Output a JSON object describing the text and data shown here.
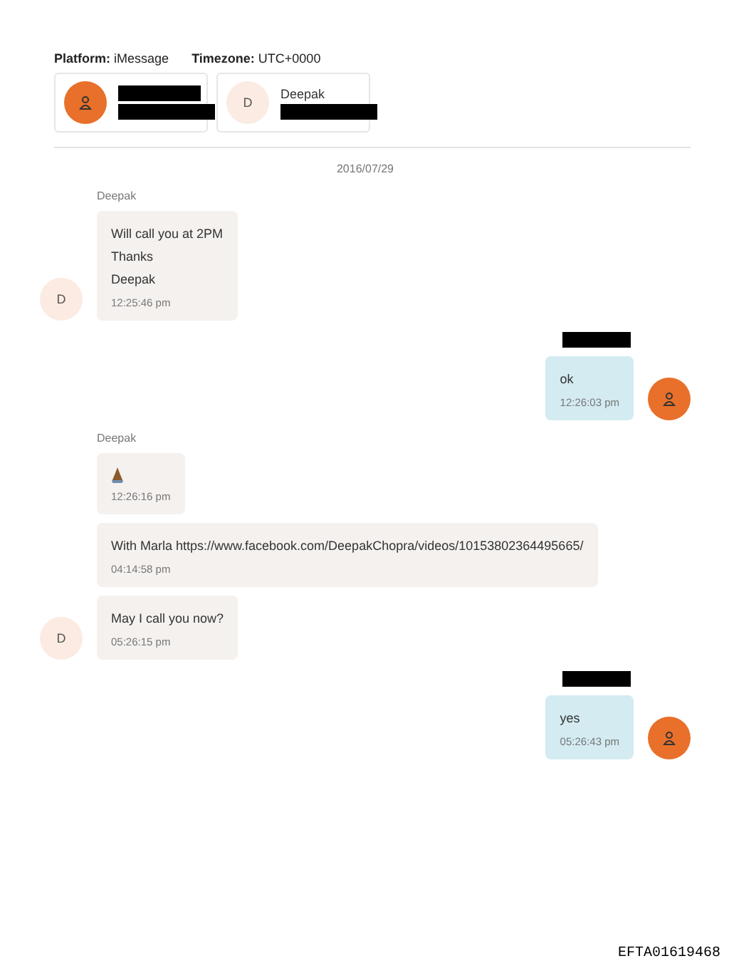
{
  "header": {
    "platform_label": "Platform:",
    "platform": "iMessage",
    "timezone_label": "Timezone:",
    "timezone": "UTC+0000"
  },
  "participants": [
    {
      "name_redacted": true,
      "detail_redacted": true
    },
    {
      "initial": "D",
      "name": "Deepak",
      "name_redacted": false,
      "detail_redacted": true
    }
  ],
  "date": "2016/07/29",
  "groups": [
    {
      "kind": "incoming",
      "sender": "Deepak",
      "initial": "D",
      "messages": [
        {
          "kind": "text",
          "lines": [
            "Will call you at 2PM",
            "Thanks",
            "Deepak"
          ],
          "time": "12:25:46 pm"
        }
      ]
    },
    {
      "kind": "outgoing",
      "sender_redacted": true,
      "messages": [
        {
          "kind": "text",
          "lines": [
            "ok"
          ],
          "time": "12:26:03 pm"
        }
      ]
    },
    {
      "kind": "incoming",
      "sender": "Deepak",
      "initial": "D",
      "messages": [
        {
          "kind": "emoji",
          "time": "12:26:16 pm"
        },
        {
          "kind": "text",
          "lines": [
            "With Marla https://www.facebook.com/DeepakChopra/videos/10153802364495665/"
          ],
          "time": "04:14:58 pm"
        },
        {
          "kind": "text",
          "lines": [
            "May I call you now?"
          ],
          "time": "05:26:15 pm"
        }
      ]
    },
    {
      "kind": "outgoing",
      "sender_redacted": true,
      "messages": [
        {
          "kind": "text",
          "lines": [
            "yes"
          ],
          "time": "05:26:43 pm"
        }
      ]
    }
  ],
  "document_id": "EFTA01619468"
}
